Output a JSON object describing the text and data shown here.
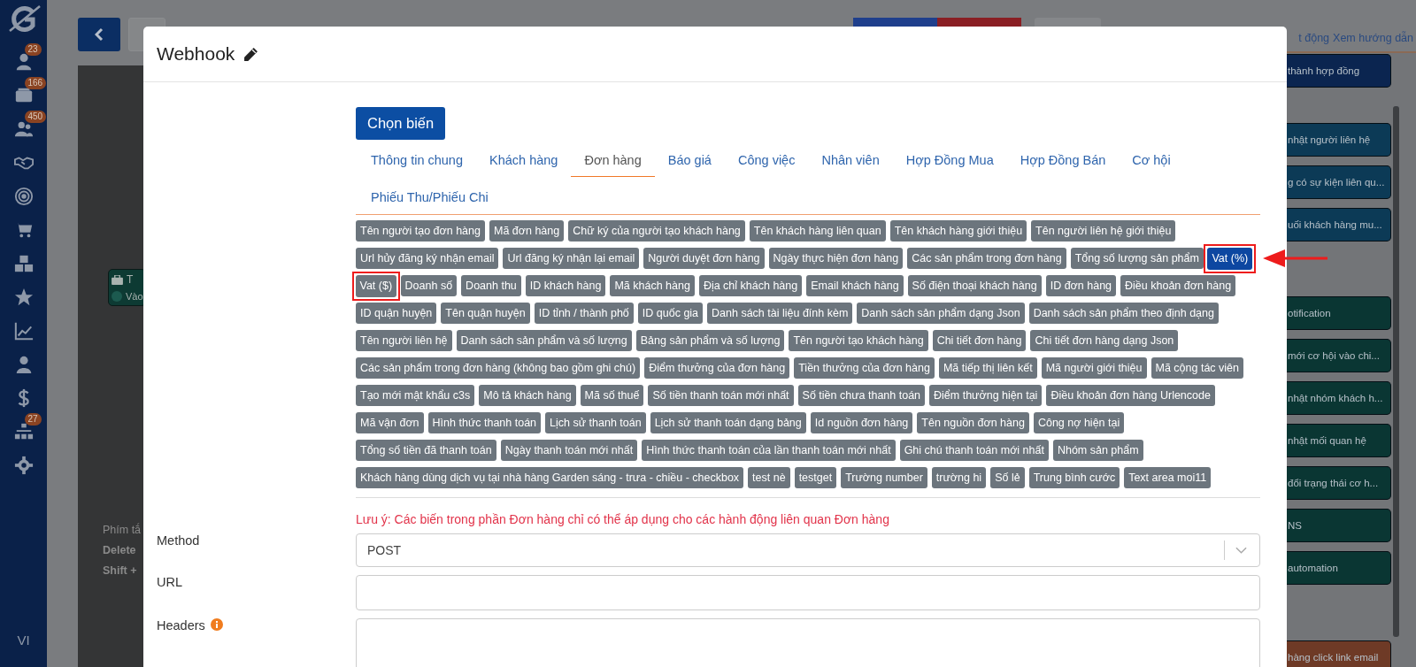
{
  "sidebar": {
    "items": [
      {
        "kind": "person",
        "badge": "23"
      },
      {
        "kind": "cards",
        "badge": "166"
      },
      {
        "kind": "people",
        "badge": "450"
      },
      {
        "kind": "handshake"
      },
      {
        "kind": "target"
      },
      {
        "kind": "cart"
      },
      {
        "kind": "cubes"
      },
      {
        "kind": "star"
      },
      {
        "kind": "chart"
      },
      {
        "kind": "user"
      },
      {
        "kind": "dollar"
      },
      {
        "kind": "sitemap",
        "badge": "27"
      },
      {
        "kind": "gear"
      }
    ],
    "language": "VI"
  },
  "header_links": [
    "t động",
    "Xem hướng dẫn"
  ],
  "canvas": {
    "node": {
      "title": "T",
      "subtitle": "Vào"
    },
    "hints": [
      {
        "text": "Phím tắ",
        "bold": false
      },
      {
        "text": "Delete",
        "bold": true
      },
      {
        "text": "Shift +",
        "bold": true
      }
    ]
  },
  "right_panel": {
    "cards": [
      {
        "text": "thành hợp đồng",
        "color": "#0b2550"
      },
      {
        "text": "nhật người liên hệ",
        "color": "#0c3a56"
      },
      {
        "text": "g có sự kiện liên qu...",
        "color": "#0c3a56"
      },
      {
        "text": "uối khách hàng mu...",
        "color": "#0c3a56"
      },
      {
        "text": "otification",
        "color": "#0a3633"
      },
      {
        "text": "mới cơ hội vào chi...",
        "color": "#0a3633"
      },
      {
        "text": "nhật nhóm khách h...",
        "color": "#0a3633"
      },
      {
        "text": "nhật mối quan hệ",
        "color": "#0a3633"
      },
      {
        "text": "đổi trạng thái cơ h...",
        "color": "#0a3633"
      },
      {
        "text": "NS",
        "color": "#0a3633"
      },
      {
        "text": "automation",
        "color": "#0a3633"
      },
      {
        "text": "hàng click link email",
        "color": "#6e3a26"
      }
    ]
  },
  "modal": {
    "title": "Webhook",
    "button": "Chọn biến",
    "tabs": [
      {
        "label": "Thông tin chung",
        "selected": false
      },
      {
        "label": "Khách hàng",
        "selected": false
      },
      {
        "label": "Đơn hàng",
        "selected": true
      },
      {
        "label": "Báo giá",
        "selected": false
      },
      {
        "label": "Công việc",
        "selected": false
      },
      {
        "label": "Nhân viên",
        "selected": false
      },
      {
        "label": "Hợp Đồng Mua",
        "selected": false
      },
      {
        "label": "Hợp Đồng Bán",
        "selected": false
      },
      {
        "label": "Cơ hội",
        "selected": false
      },
      {
        "label": "Phiếu Thu/Phiếu Chi",
        "selected": false
      }
    ],
    "tags": [
      {
        "label": "Tên người tạo đơn hàng",
        "selected": false,
        "highlighted": false
      },
      {
        "label": "Mã đơn hàng",
        "selected": false,
        "highlighted": false
      },
      {
        "label": "Chữ ký của người tạo khách hàng",
        "selected": false,
        "highlighted": false
      },
      {
        "label": "Tên khách hàng liên quan",
        "selected": false,
        "highlighted": false
      },
      {
        "label": "Tên khách hàng giới thiệu",
        "selected": false,
        "highlighted": false
      },
      {
        "label": "Tên người liên hệ giới thiệu",
        "selected": false,
        "highlighted": false
      },
      {
        "label": "Url hủy đăng ký nhận email",
        "selected": false,
        "highlighted": false
      },
      {
        "label": "Url đăng ký nhận lại email",
        "selected": false,
        "highlighted": false
      },
      {
        "label": "Người duyệt đơn hàng",
        "selected": false,
        "highlighted": false
      },
      {
        "label": "Ngày thực hiện đơn hàng",
        "selected": false,
        "highlighted": false
      },
      {
        "label": "Các sản phẩm trong đơn hàng",
        "selected": false,
        "highlighted": false
      },
      {
        "label": "Tổng số lượng sản phẩm",
        "selected": false,
        "highlighted": false
      },
      {
        "label": "Vat (%)",
        "selected": true,
        "highlighted": true
      },
      {
        "label": "Vat ($)",
        "selected": false,
        "highlighted": true
      },
      {
        "label": "Doanh số",
        "selected": false,
        "highlighted": false
      },
      {
        "label": "Doanh thu",
        "selected": false,
        "highlighted": false
      },
      {
        "label": "ID khách hàng",
        "selected": false,
        "highlighted": false
      },
      {
        "label": "Mã khách hàng",
        "selected": false,
        "highlighted": false
      },
      {
        "label": "Địa chỉ khách hàng",
        "selected": false,
        "highlighted": false
      },
      {
        "label": "Email khách hàng",
        "selected": false,
        "highlighted": false
      },
      {
        "label": "Số điện thoại khách hàng",
        "selected": false,
        "highlighted": false
      },
      {
        "label": "ID đơn hàng",
        "selected": false,
        "highlighted": false
      },
      {
        "label": "Điều khoản đơn hàng",
        "selected": false,
        "highlighted": false
      },
      {
        "label": "ID quận huyện",
        "selected": false,
        "highlighted": false
      },
      {
        "label": "Tên quận huyện",
        "selected": false,
        "highlighted": false
      },
      {
        "label": "ID tỉnh / thành phố",
        "selected": false,
        "highlighted": false
      },
      {
        "label": "ID quốc gia",
        "selected": false,
        "highlighted": false
      },
      {
        "label": "Danh sách tài liệu đính kèm",
        "selected": false,
        "highlighted": false
      },
      {
        "label": "Danh sách sản phẩm dạng Json",
        "selected": false,
        "highlighted": false
      },
      {
        "label": "Danh sách sản phẩm theo định dạng",
        "selected": false,
        "highlighted": false
      },
      {
        "label": "Tên người liên hệ",
        "selected": false,
        "highlighted": false
      },
      {
        "label": "Danh sách sản phẩm và số lượng",
        "selected": false,
        "highlighted": false
      },
      {
        "label": "Bảng sản phẩm và số lượng",
        "selected": false,
        "highlighted": false
      },
      {
        "label": "Tên người tạo khách hàng",
        "selected": false,
        "highlighted": false
      },
      {
        "label": "Chi tiết đơn hàng",
        "selected": false,
        "highlighted": false
      },
      {
        "label": "Chi tiết đơn hàng dạng Json",
        "selected": false,
        "highlighted": false
      },
      {
        "label": "Các sản phẩm trong đơn hàng (không bao gồm ghi chú)",
        "selected": false,
        "highlighted": false
      },
      {
        "label": "Điểm thưởng của đơn hàng",
        "selected": false,
        "highlighted": false
      },
      {
        "label": "Tiền thưởng của đơn hàng",
        "selected": false,
        "highlighted": false
      },
      {
        "label": "Mã tiếp thị liên kết",
        "selected": false,
        "highlighted": false
      },
      {
        "label": "Mã người giới thiệu",
        "selected": false,
        "highlighted": false
      },
      {
        "label": "Mã cộng tác viên",
        "selected": false,
        "highlighted": false
      },
      {
        "label": "Tạo mới mật khẩu c3s",
        "selected": false,
        "highlighted": false
      },
      {
        "label": "Mô tả khách hàng",
        "selected": false,
        "highlighted": false
      },
      {
        "label": "Mã số thuế",
        "selected": false,
        "highlighted": false
      },
      {
        "label": "Số tiền thanh toán mới nhất",
        "selected": false,
        "highlighted": false
      },
      {
        "label": "Số tiền chưa thanh toán",
        "selected": false,
        "highlighted": false
      },
      {
        "label": "Điểm thưởng hiện tại",
        "selected": false,
        "highlighted": false
      },
      {
        "label": "Điều khoản đơn hàng Urlencode",
        "selected": false,
        "highlighted": false
      },
      {
        "label": "Mã vận đơn",
        "selected": false,
        "highlighted": false
      },
      {
        "label": "Hình thức thanh toán",
        "selected": false,
        "highlighted": false
      },
      {
        "label": "Lịch sử thanh toán",
        "selected": false,
        "highlighted": false
      },
      {
        "label": "Lịch sử thanh toán dạng bảng",
        "selected": false,
        "highlighted": false
      },
      {
        "label": "Id nguồn đơn hàng",
        "selected": false,
        "highlighted": false
      },
      {
        "label": "Tên nguồn đơn hàng",
        "selected": false,
        "highlighted": false
      },
      {
        "label": "Công nợ hiện tại",
        "selected": false,
        "highlighted": false
      },
      {
        "label": "Tổng số tiền đã thanh toán",
        "selected": false,
        "highlighted": false
      },
      {
        "label": "Ngày thanh toán mới nhất",
        "selected": false,
        "highlighted": false
      },
      {
        "label": "Hình thức thanh toán của lần thanh toán mới nhất",
        "selected": false,
        "highlighted": false
      },
      {
        "label": "Ghi chú thanh toán mới nhất",
        "selected": false,
        "highlighted": false
      },
      {
        "label": "Nhóm sản phẩm",
        "selected": false,
        "highlighted": false
      },
      {
        "label": "Khách hàng dùng dịch vụ tại nhà hàng Garden sáng - trưa - chiều - checkbox",
        "selected": false,
        "highlighted": false
      },
      {
        "label": "test nè",
        "selected": false,
        "highlighted": false
      },
      {
        "label": "testget",
        "selected": false,
        "highlighted": false
      },
      {
        "label": "Trường number",
        "selected": false,
        "highlighted": false
      },
      {
        "label": "trường hi",
        "selected": false,
        "highlighted": false
      },
      {
        "label": "Số lẻ",
        "selected": false,
        "highlighted": false
      },
      {
        "label": "Trung bình cước",
        "selected": false,
        "highlighted": false
      },
      {
        "label": "Text area moi11",
        "selected": false,
        "highlighted": false
      }
    ],
    "note": "Lưu ý: Các biến trong phần Đơn hàng chỉ có thể áp dụng cho các hành động liên quan Đơn hàng",
    "fields": [
      {
        "label": "Method",
        "kind": "select",
        "value": "POST",
        "info": false
      },
      {
        "label": "URL",
        "kind": "input",
        "info": false
      },
      {
        "label": "Headers",
        "kind": "textarea",
        "info": true
      }
    ]
  }
}
